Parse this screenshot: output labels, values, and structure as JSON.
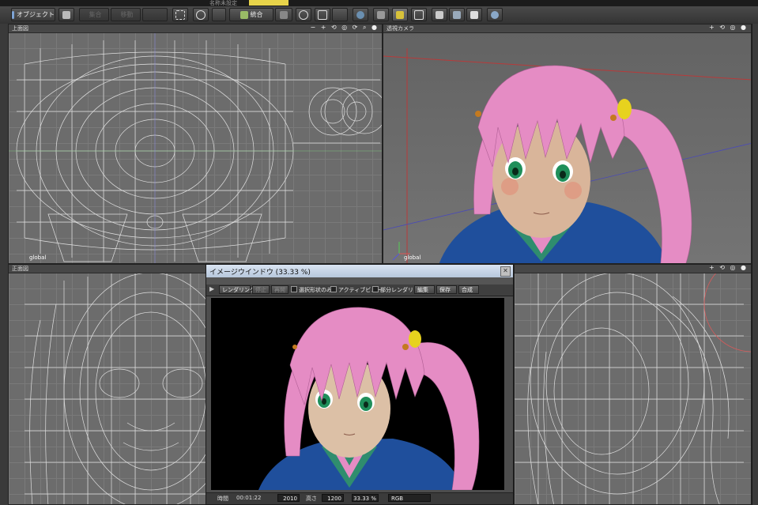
{
  "topstrip": {
    "text1": "名称未設定"
  },
  "toolbar": {
    "object_label": "オブジェクト",
    "b1": "集合",
    "b2": "移動",
    "combine_label": "統合"
  },
  "viewports": {
    "top": {
      "name": "上面図",
      "footer": "global"
    },
    "perspective": {
      "name": "透視カメラ",
      "footer": "global"
    },
    "front": {
      "name": "正面図"
    },
    "side": {
      "name": ""
    }
  },
  "image_window": {
    "title": "イメージウインドウ (33.33 %)",
    "render_button": "レンダリング",
    "stop_button": "停止",
    "resume_button": "再開",
    "check_selected": "選択形状のみ",
    "check_active": "アクティブビュー",
    "check_partial": "部分レンダリング",
    "edit_button": "編集",
    "save_button": "保存",
    "composite_button": "合成",
    "status": {
      "time_label": "時間",
      "time_value": "00:01:22",
      "width_value": "2010",
      "height_label": "高さ",
      "height_value": "1200",
      "zoom_value": "33.33 %",
      "mode_value": "RGB"
    }
  },
  "colors": {
    "hair": "#e58cc4",
    "eyes": "#1f8f5a",
    "jacket": "#1f4f9c",
    "collar": "#2f8d6e"
  }
}
